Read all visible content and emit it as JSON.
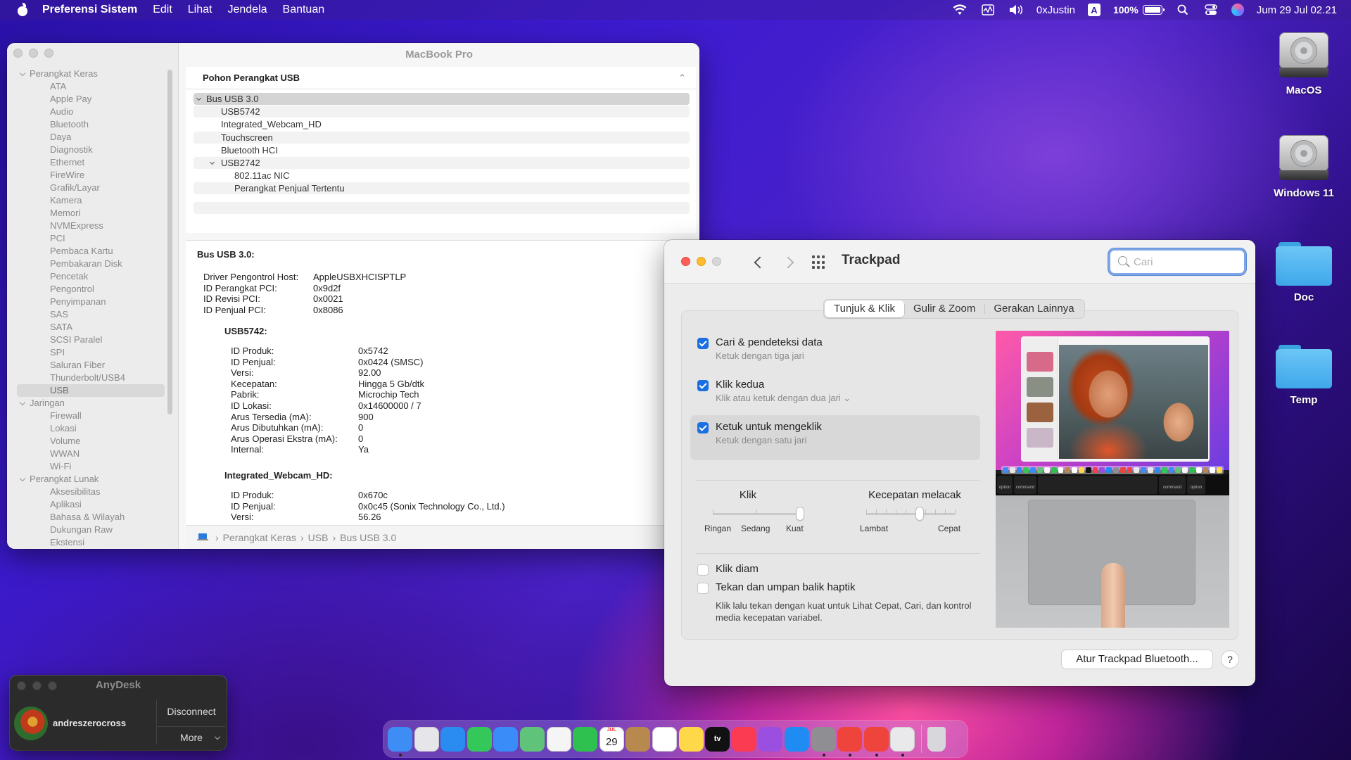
{
  "menubar": {
    "app_name": "Preferensi Sistem",
    "menus": [
      "Edit",
      "Lihat",
      "Jendela",
      "Bantuan"
    ],
    "username": "0xJustin",
    "input_source": "A",
    "battery": "100%",
    "datetime": "Jum 29 Jul  02.21"
  },
  "system_info": {
    "window_title": "MacBook Pro",
    "sidebar": [
      {
        "label": "Perangkat Keras",
        "kind": "category"
      },
      {
        "label": "ATA",
        "kind": "item"
      },
      {
        "label": "Apple Pay",
        "kind": "item"
      },
      {
        "label": "Audio",
        "kind": "item"
      },
      {
        "label": "Bluetooth",
        "kind": "item"
      },
      {
        "label": "Daya",
        "kind": "item"
      },
      {
        "label": "Diagnostik",
        "kind": "item"
      },
      {
        "label": "Ethernet",
        "kind": "item"
      },
      {
        "label": "FireWire",
        "kind": "item"
      },
      {
        "label": "Grafik/Layar",
        "kind": "item"
      },
      {
        "label": "Kamera",
        "kind": "item"
      },
      {
        "label": "Memori",
        "kind": "item"
      },
      {
        "label": "NVMExpress",
        "kind": "item"
      },
      {
        "label": "PCI",
        "kind": "item"
      },
      {
        "label": "Pembaca Kartu",
        "kind": "item"
      },
      {
        "label": "Pembakaran Disk",
        "kind": "item"
      },
      {
        "label": "Pencetak",
        "kind": "item"
      },
      {
        "label": "Pengontrol",
        "kind": "item"
      },
      {
        "label": "Penyimpanan",
        "kind": "item"
      },
      {
        "label": "SAS",
        "kind": "item"
      },
      {
        "label": "SATA",
        "kind": "item"
      },
      {
        "label": "SCSI Paralel",
        "kind": "item"
      },
      {
        "label": "SPI",
        "kind": "item"
      },
      {
        "label": "Saluran Fiber",
        "kind": "item"
      },
      {
        "label": "Thunderbolt/USB4",
        "kind": "item"
      },
      {
        "label": "USB",
        "kind": "item",
        "selected": true
      },
      {
        "label": "Jaringan",
        "kind": "category"
      },
      {
        "label": "Firewall",
        "kind": "item"
      },
      {
        "label": "Lokasi",
        "kind": "item"
      },
      {
        "label": "Volume",
        "kind": "item"
      },
      {
        "label": "WWAN",
        "kind": "item"
      },
      {
        "label": "Wi-Fi",
        "kind": "item"
      },
      {
        "label": "Perangkat Lunak",
        "kind": "category"
      },
      {
        "label": "Aksesibilitas",
        "kind": "item"
      },
      {
        "label": "Aplikasi",
        "kind": "item"
      },
      {
        "label": "Bahasa & Wilayah",
        "kind": "item"
      },
      {
        "label": "Dukungan Raw",
        "kind": "item"
      },
      {
        "label": "Ekstensi",
        "kind": "item"
      }
    ],
    "tree_header": "Pohon Perangkat USB",
    "tree": [
      {
        "label": "Bus USB 3.0",
        "level": 0,
        "expandable": true,
        "selected": true
      },
      {
        "label": "USB5742",
        "level": 1
      },
      {
        "label": "Integrated_Webcam_HD",
        "level": 1
      },
      {
        "label": "Touchscreen",
        "level": 1
      },
      {
        "label": "Bluetooth HCI",
        "level": 1
      },
      {
        "label": "USB2742",
        "level": 1,
        "expandable": true
      },
      {
        "label": "802.11ac NIC",
        "level": 2
      },
      {
        "label": "Perangkat Penjual Tertentu",
        "level": 2
      }
    ],
    "detail": {
      "title": "Bus USB 3.0:",
      "bus_rows": [
        {
          "k": "Driver Pengontrol Host:",
          "v": "AppleUSBXHCISPTLP"
        },
        {
          "k": "ID Perangkat PCI:",
          "v": "0x9d2f"
        },
        {
          "k": "ID Revisi PCI:",
          "v": "0x0021"
        },
        {
          "k": "ID Penjual PCI:",
          "v": "0x8086"
        }
      ],
      "dev1_title": "USB5742:",
      "dev1_rows": [
        {
          "k": "ID Produk:",
          "v": "0x5742"
        },
        {
          "k": "ID Penjual:",
          "v": "0x0424  (SMSC)"
        },
        {
          "k": "Versi:",
          "v": "92.00"
        },
        {
          "k": "Kecepatan:",
          "v": "Hingga 5 Gb/dtk"
        },
        {
          "k": "Pabrik:",
          "v": "Microchip Tech"
        },
        {
          "k": "ID Lokasi:",
          "v": "0x14600000 / 7"
        },
        {
          "k": "Arus Tersedia (mA):",
          "v": "900"
        },
        {
          "k": "Arus Dibutuhkan (mA):",
          "v": "0"
        },
        {
          "k": "Arus Operasi Ekstra (mA):",
          "v": "0"
        },
        {
          "k": "Internal:",
          "v": "Ya"
        }
      ],
      "dev2_title": "Integrated_Webcam_HD:",
      "dev2_rows": [
        {
          "k": "ID Produk:",
          "v": "0x670c"
        },
        {
          "k": "ID Penjual:",
          "v": "0x0c45  (Sonix Technology Co., Ltd.)"
        },
        {
          "k": "Versi:",
          "v": "56.26"
        }
      ]
    },
    "path": [
      "Perangkat Keras",
      "USB",
      "Bus USB 3.0"
    ]
  },
  "trackpad": {
    "title": "Trackpad",
    "search_placeholder": "Cari",
    "tabs": [
      "Tunjuk & Klik",
      "Gulir & Zoom",
      "Gerakan Lainnya"
    ],
    "active_tab": 0,
    "options": [
      {
        "label": "Cari & pendeteksi data",
        "sub": "Ketuk dengan tiga jari",
        "checked": true
      },
      {
        "label": "Klik kedua",
        "sub": "Klik atau ketuk dengan dua jari",
        "checked": true,
        "has_menu": true
      },
      {
        "label": "Ketuk untuk mengeklik",
        "sub": "Ketuk dengan satu jari",
        "checked": true
      }
    ],
    "click_slider": {
      "title": "Klik",
      "labels": [
        "Ringan",
        "Sedang",
        "Kuat"
      ],
      "value_index": 2
    },
    "speed_slider": {
      "title": "Kecepatan melacak",
      "labels": [
        "Lambat",
        "Cepat"
      ],
      "value_fraction": 0.6
    },
    "silent_click": {
      "label": "Klik diam",
      "checked": false
    },
    "force_click": {
      "label": "Tekan dan umpan balik haptik",
      "checked": false,
      "desc": "Klik lalu tekan dengan kuat untuk Lihat Cepat, Cari, dan kontrol media kecepatan variabel."
    },
    "preview_keys": [
      "option",
      "command",
      "command",
      "option"
    ],
    "setup_button": "Atur Trackpad Bluetooth...",
    "help": "?"
  },
  "desktop_icons": [
    {
      "label": "MacOS",
      "kind": "hdd"
    },
    {
      "label": "Windows 11",
      "kind": "hdd"
    },
    {
      "label": "Doc",
      "kind": "folder"
    },
    {
      "label": "Temp",
      "kind": "folder"
    }
  ],
  "anydesk": {
    "title": "AnyDesk",
    "user": "andreszerocross",
    "disconnect": "Disconnect",
    "more": "More"
  },
  "dock": {
    "apps": [
      {
        "name": "finder-icon",
        "color": "#3d8df5",
        "running": true
      },
      {
        "name": "launchpad-icon",
        "color": "#e6e6ea"
      },
      {
        "name": "safari-icon",
        "color": "#2a8cf0"
      },
      {
        "name": "messages-icon",
        "color": "#34c759"
      },
      {
        "name": "mail-icon",
        "color": "#3a8df8"
      },
      {
        "name": "maps-icon",
        "color": "#5fc47a"
      },
      {
        "name": "photos-icon",
        "color": "#f5f5f5"
      },
      {
        "name": "facetime-icon",
        "color": "#2fc14f"
      },
      {
        "name": "calendar-icon",
        "color": "#ffffff",
        "text": "29",
        "month": "JUL"
      },
      {
        "name": "contacts-icon",
        "color": "#b8894f"
      },
      {
        "name": "reminders-icon",
        "color": "#ffffff"
      },
      {
        "name": "notes-icon",
        "color": "#ffd84a"
      },
      {
        "name": "tv-icon",
        "color": "#111111",
        "text": "tv"
      },
      {
        "name": "music-icon",
        "color": "#fa3b52"
      },
      {
        "name": "podcasts-icon",
        "color": "#9b4fe0"
      },
      {
        "name": "app-store-icon",
        "color": "#1f8cf4"
      },
      {
        "name": "system-preferences-icon",
        "color": "#8e8e93",
        "running": true
      },
      {
        "name": "anydesk-icon",
        "color": "#ef443b",
        "running": true
      },
      {
        "name": "anydesk-alt-icon",
        "color": "#ef443b",
        "running": true
      },
      {
        "name": "printer-icon",
        "color": "#e9e9ec",
        "running": true
      }
    ],
    "trash": {
      "name": "trash-icon",
      "color": "#d8d8dc"
    }
  }
}
